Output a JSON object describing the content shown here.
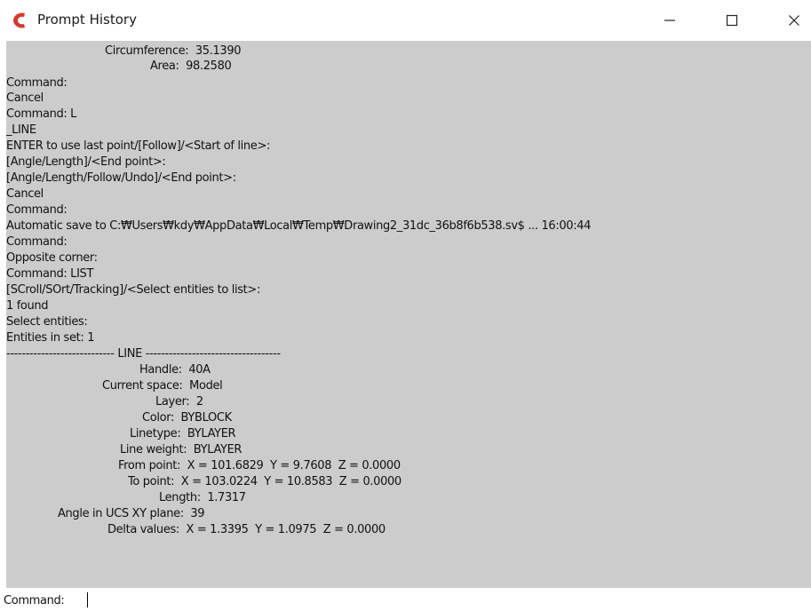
{
  "window": {
    "title": "Prompt History",
    "controls": {
      "minimize": "—",
      "maximize": "☐",
      "close": "✕"
    },
    "accent_color": "#d9362b"
  },
  "history": {
    "lines": [
      "Circumference:  35.1390",
      "Area:  98.2580",
      "Command:",
      "Cancel",
      "Command: L",
      "_LINE",
      "ENTER to use last point/[Follow]/<Start of line>:",
      "[Angle/Length]/<End point>:",
      "[Angle/Length/Follow/Undo]/<End point>:",
      "Cancel",
      "Command:",
      "Automatic save to C:₩Users₩kdy₩AppData₩Local₩Temp₩Drawing2_31dc_36b8f6b538.sv$ ... 16:00:44",
      "Command:",
      "Opposite corner:",
      "Command: LIST",
      "[SCroll/SOrt/Tracking]/<Select entities to list>:",
      "1 found",
      "Select entities:",
      "Entities in set: 1",
      "---------------------------- LINE -----------------------------------",
      "Handle:  40A",
      "Current space:  Model",
      "Layer:  2",
      "Color:  BYBLOCK",
      "Linetype:  BYLAYER",
      "Line weight:  BYLAYER",
      "From point:  X = 101.6829  Y = 9.7608  Z = 0.0000",
      "To point:  X = 103.0224  Y = 10.8583  Z = 0.0000",
      "Length:  1.7317",
      "Angle in UCS XY plane:  39",
      "Delta values:  X = 1.3395  Y = 1.0975  Z = 0.0000"
    ]
  },
  "prompt": {
    "label": "Command:",
    "value": ""
  }
}
